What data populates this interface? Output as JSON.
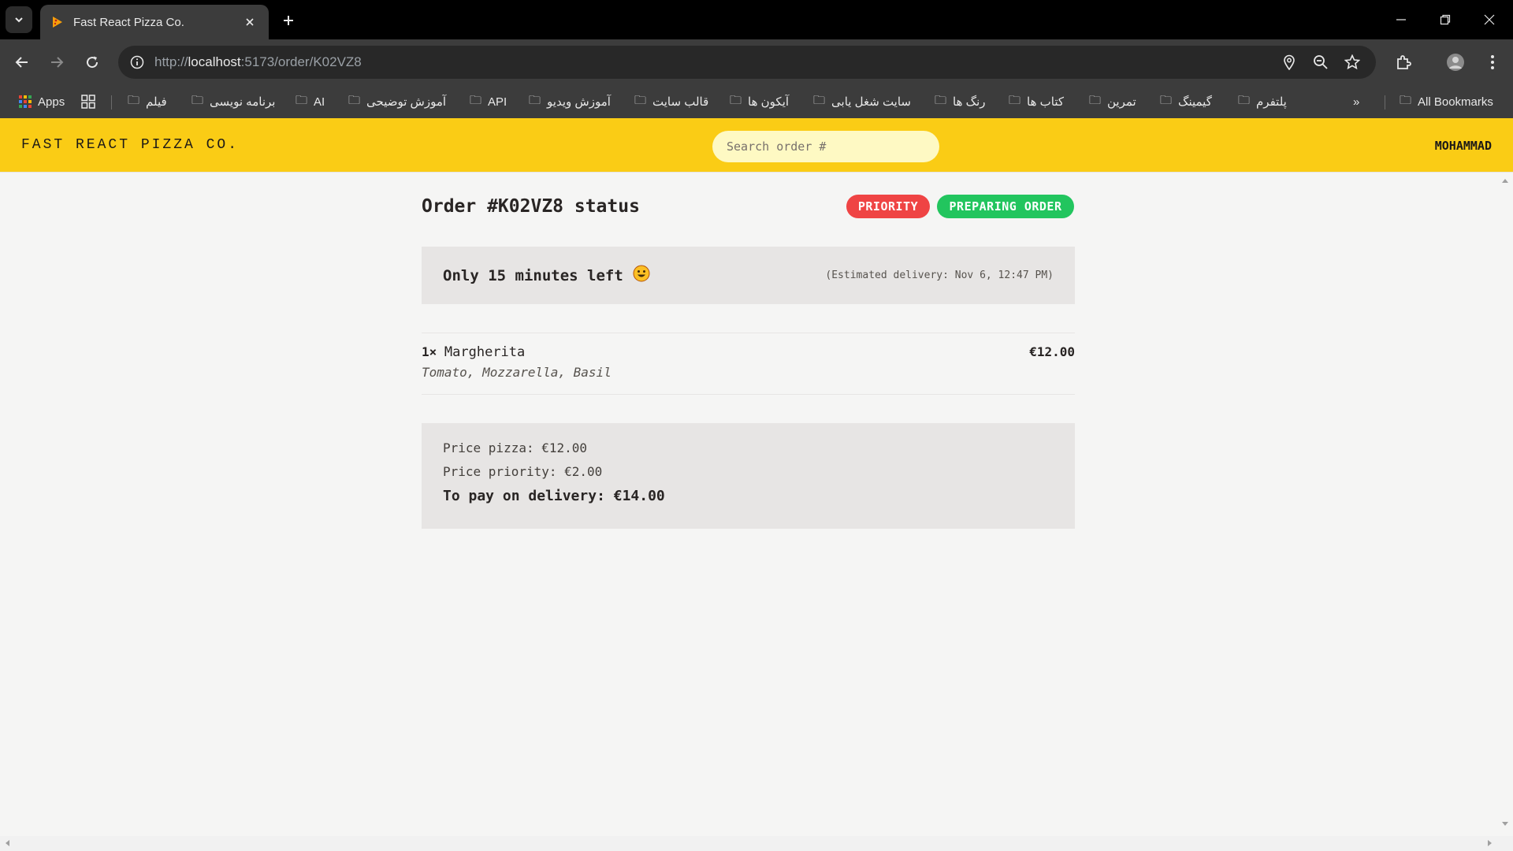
{
  "browser": {
    "tab_title": "Fast React Pizza Co.",
    "url_prefix": "http://",
    "url_host": "localhost",
    "url_rest": ":5173/order/K02VZ8",
    "bookmarks": [
      {
        "label": "Apps",
        "icon": "apps-grid-icon"
      },
      {
        "label": "فیلم",
        "icon": "folder-icon"
      },
      {
        "label": "برنامه نویسی",
        "icon": "folder-icon"
      },
      {
        "label": "AI",
        "icon": "folder-icon"
      },
      {
        "label": "آموزش توضیحی",
        "icon": "folder-icon"
      },
      {
        "label": "API",
        "icon": "folder-icon"
      },
      {
        "label": "آموزش ویدیو",
        "icon": "folder-icon"
      },
      {
        "label": "قالب سایت",
        "icon": "folder-icon"
      },
      {
        "label": "آیکون ها",
        "icon": "folder-icon"
      },
      {
        "label": "سایت شغل یابی",
        "icon": "folder-icon"
      },
      {
        "label": "رنگ ها",
        "icon": "folder-icon"
      },
      {
        "label": "کتاب ها",
        "icon": "folder-icon"
      },
      {
        "label": "تمرین",
        "icon": "folder-icon"
      },
      {
        "label": "گیمینگ",
        "icon": "folder-icon"
      },
      {
        "label": "پلتفرم",
        "icon": "folder-icon"
      }
    ],
    "all_bookmarks": "All Bookmarks"
  },
  "header": {
    "logo": "FAST REACT PIZZA CO.",
    "search_placeholder": "Search order #",
    "username": "MOHAMMAD"
  },
  "order": {
    "title": "Order #K02VZ8 status",
    "priority_badge": "PRIORITY",
    "status_badge": "PREPARING ORDER",
    "time_left": "Only 15 minutes left",
    "time_left_emoji": "😃",
    "estimated_delivery": "(Estimated delivery: Nov 6, 12:47 PM)",
    "items": [
      {
        "quantity": "1×",
        "name": "Margherita",
        "price": "€12.00",
        "ingredients": "Tomato, Mozzarella, Basil"
      }
    ],
    "price_pizza": "Price pizza: €12.00",
    "price_priority": "Price priority: €2.00",
    "to_pay": "To pay on delivery: €14.00"
  },
  "colors": {
    "header_bg": "#facc15",
    "priority": "#ef4444",
    "status": "#22c55e",
    "page_bg": "#f5f5f4",
    "box_bg": "#e7e5e4"
  }
}
